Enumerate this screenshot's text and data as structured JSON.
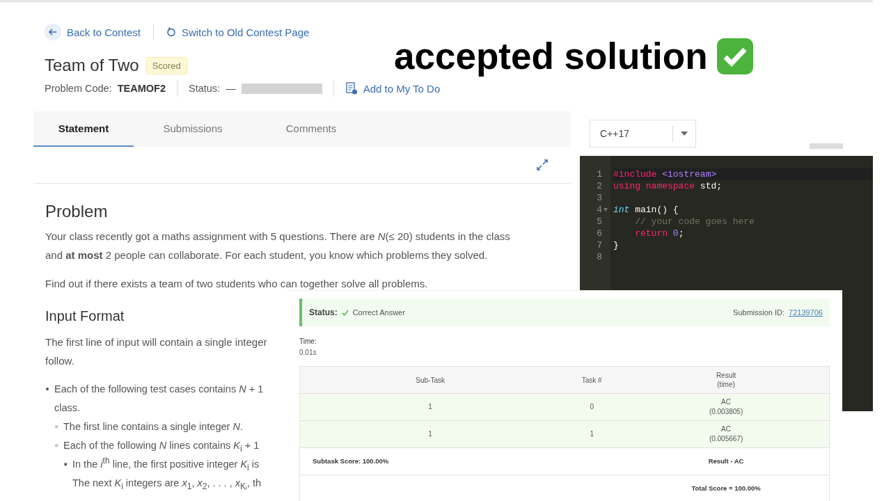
{
  "header": {
    "back_link": "Back to Contest",
    "switch_link": "Switch to Old Contest Page",
    "title": "Team of Two",
    "badge": "Scored",
    "problem_code_label": "Problem Code:",
    "problem_code": "TEAMOF2",
    "status_label": "Status:",
    "status_value": "—",
    "todo_link": "Add to My To Do"
  },
  "caption": "accepted solution",
  "tabs": [
    {
      "label": "Statement",
      "selected": true
    },
    {
      "label": "Submissions",
      "selected": false
    },
    {
      "label": "Comments",
      "selected": false
    }
  ],
  "statement": {
    "sections": [
      {
        "heading": "Problem",
        "paragraphs": [
          [
            "Your class recently got a maths assignment with 5 questions. There are *N*(≤ 20) students in the class",
            "and **at most** 2 people can collaborate. For each student, you know which problems they solved."
          ],
          [
            "Find out if there exists a team of two students who can together solve all problems."
          ]
        ]
      },
      {
        "heading": "Input Format",
        "paragraphs": [
          [
            "The first line of input will contain a single integer",
            "follow."
          ]
        ],
        "list": [
          {
            "marker": "•",
            "lines": [
              "Each of the following test cases contains *N* + 1",
              "class."
            ],
            "children": [
              {
                "marker": "◦",
                "lines": [
                  "The first line contains a single integer *N*."
                ]
              },
              {
                "marker": "◦",
                "lines": [
                  "Each of the following *N* lines contains *K*$_{i}$ + 1"
                ],
                "children": [
                  {
                    "marker": "▪",
                    "lines": [
                      "In the *i*$^{th}$ line, the first positive integer *K*$_{i}$ is",
                      "The next *K*$_{i}$ integers are *x*$_{1}$, *x*$_{2}$, . . . , *x*$_{Kᵢ}$, th"
                    ]
                  }
                ]
              }
            ]
          }
        ]
      }
    ]
  },
  "editor": {
    "language": "C++17",
    "lines": [
      {
        "number": "1",
        "tokens": [
          {
            "kind": "keyword",
            "text": "#include "
          },
          {
            "kind": "header",
            "text": "<iostream>"
          }
        ]
      },
      {
        "number": "2",
        "tokens": [
          {
            "kind": "keyword",
            "text": "using namespace "
          },
          {
            "kind": "plain",
            "text": "std;"
          }
        ]
      },
      {
        "number": "3"
      },
      {
        "number": "4",
        "foldable": true,
        "tokens": [
          {
            "kind": "type",
            "text": "int"
          },
          {
            "kind": "plain",
            "text": " main() {"
          }
        ]
      },
      {
        "number": "5",
        "tokens": [
          {
            "kind": "comment",
            "text": "    // your code goes here"
          }
        ]
      },
      {
        "number": "6",
        "tokens": [
          {
            "kind": "keyword",
            "text": "    return "
          },
          {
            "kind": "number",
            "text": "0"
          },
          {
            "kind": "plain",
            "text": ";"
          }
        ]
      },
      {
        "number": "7",
        "tokens": [
          {
            "kind": "plain",
            "text": "}"
          }
        ]
      },
      {
        "number": "8"
      }
    ]
  },
  "result": {
    "status_label": "Status:",
    "status_value": "Correct Answer",
    "submission_label": "Submission ID:",
    "submission_id": "72139706",
    "time_label": "Time:",
    "time_value": "0.01s",
    "columns": [
      "Sub-Task",
      "Task #",
      "Result\n(time)"
    ],
    "rows": [
      {
        "passed": true,
        "cells": [
          "1",
          "0",
          "AC\n(0.003805)"
        ]
      },
      {
        "passed": true,
        "cells": [
          "1",
          "1",
          "AC\n(0.005667)"
        ]
      }
    ],
    "subtask_score": "Subtask Score: 100.00%",
    "result_summary": "Result - AC",
    "total_score": "Total Score = 100.00%"
  }
}
